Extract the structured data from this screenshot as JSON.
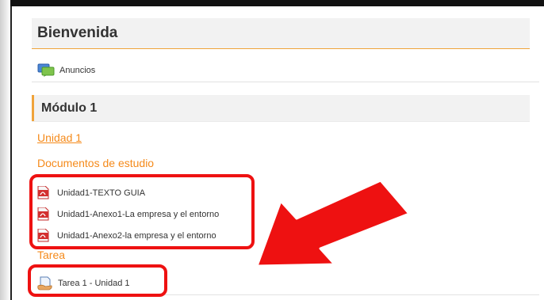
{
  "welcome": {
    "title": "Bienvenida",
    "announcements_label": "Anuncios"
  },
  "module": {
    "title": "Módulo 1",
    "unit_link": "Unidad 1",
    "documents_heading": "Documentos de estudio",
    "documents": [
      {
        "label": "Unidad1-TEXTO GUIA",
        "icon": "pdf-icon"
      },
      {
        "label": "Unidad1-Anexo1-La empresa y el entorno",
        "icon": "pdf-icon"
      },
      {
        "label": "Unidad1-Anexo2-la empresa y el entorno",
        "icon": "pdf-icon"
      }
    ],
    "task_heading": "Tarea",
    "task": {
      "label": "Tarea 1 - Unidad 1",
      "icon": "assignment-icon"
    }
  },
  "colors": {
    "accent_orange": "#f58a1a",
    "highlight_red": "#ee1111"
  }
}
